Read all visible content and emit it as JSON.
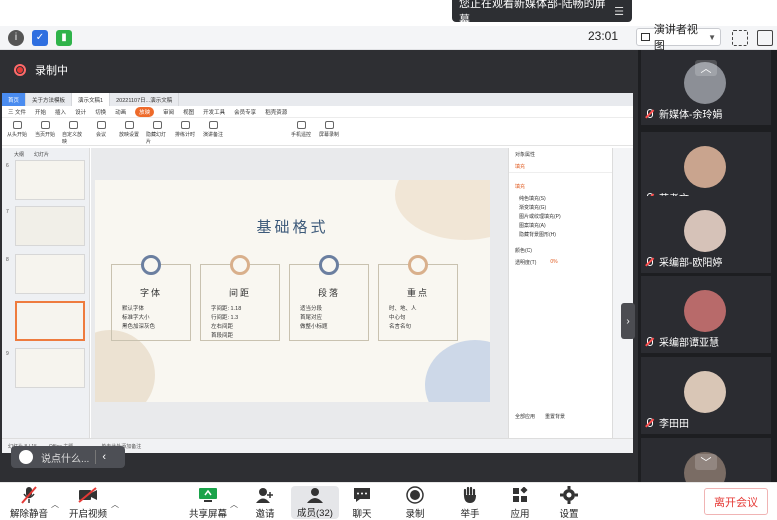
{
  "banner": {
    "text": "您正在观看新媒体部-陆畅的屏幕"
  },
  "topbar": {
    "time": "23:01",
    "presenter_view": "演讲者视图"
  },
  "stage": {
    "recording_label": "录制中"
  },
  "wps": {
    "tabs": [
      "首页",
      "关于方法模板",
      "演示文稿1",
      "20221107日...演示文稿"
    ],
    "menu": [
      "三 文件",
      "开始",
      "插入",
      "设计",
      "切换",
      "动画",
      "放映",
      "审阅",
      "视图",
      "开发工具",
      "会员专享",
      "稻壳资源"
    ],
    "menu_highlight": "放映",
    "ribbon": [
      "从头开始",
      "当页开始",
      "自定义放映",
      "会议",
      "放映设置",
      "隐藏幻灯片",
      "排练计时",
      "演讲备注",
      "手机遥控",
      "屏幕录制"
    ],
    "left_tabs": [
      "大纲",
      "幻灯片"
    ],
    "slide_numbers": [
      "6",
      "7",
      "8",
      "9"
    ],
    "slide_title": "基础格式",
    "cards": [
      {
        "title": "字体",
        "lines": "默认字体\n标准字大小\n黑色加深灰色"
      },
      {
        "title": "间距",
        "lines": "字间距: 1.18\n行间距: 1.3\n左右间距\n首段间距"
      },
      {
        "title": "段落",
        "lines": "适当分段\n首尾对应\n做整小标题"
      },
      {
        "title": "重点",
        "lines": "时、地、人\n中心句\n名言名句"
      }
    ],
    "right_panel": {
      "title": "对象属性",
      "tab": "填充",
      "section": "填充",
      "options": [
        "纯色填充(S)",
        "渐变填充(G)",
        "图片或纹理填充(P)",
        "图案填充(A)",
        "隐藏背景图形(H)"
      ],
      "color_label": "颜色(C)",
      "transparency_label": "透明度(T)",
      "transparency_value": "0%",
      "bottom_buttons": [
        "全部应用",
        "重置背景"
      ]
    },
    "status_left": "幻灯片 8 / 15",
    "status_theme": "Office 主题",
    "notes_placeholder": "单击此处添加备注"
  },
  "comment_box": {
    "placeholder": "说点什么..."
  },
  "participants": [
    {
      "name": "新媒体-余玲娟",
      "color": "#8c8f96"
    },
    {
      "name": "范孝文",
      "color": "#c9a48e"
    },
    {
      "name": "采编部-欧阳婷",
      "color": "#d6c2b8"
    },
    {
      "name": "采编部谭亚慧",
      "color": "#b86a6a"
    },
    {
      "name": "李田田",
      "color": "#d9c6b6"
    },
    {
      "name": "",
      "color": "#7a6c64"
    }
  ],
  "toolbar": {
    "mute": "解除静音",
    "video": "开启视频",
    "share": "共享屏幕",
    "invite": "邀请",
    "members": "成员(32)",
    "chat": "聊天",
    "record": "录制",
    "raise_hand": "举手",
    "apps": "应用",
    "settings": "设置",
    "leave": "离开会议"
  }
}
